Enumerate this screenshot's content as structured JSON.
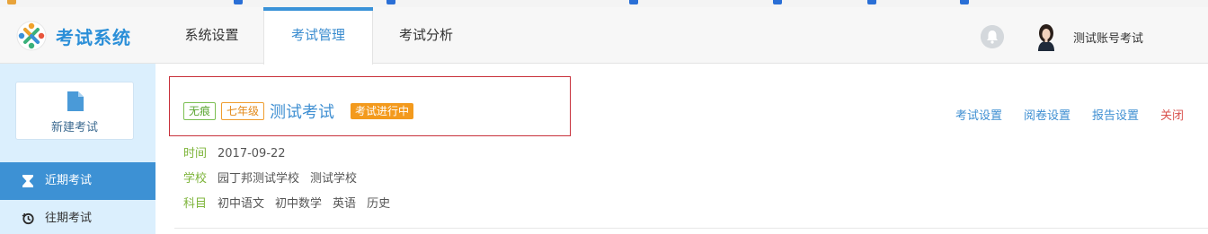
{
  "header": {
    "logo_text": "考试系统",
    "tabs": [
      {
        "label": "系统设置"
      },
      {
        "label": "考试管理"
      },
      {
        "label": "考试分析"
      }
    ],
    "user_name": "测试账号考试"
  },
  "sidebar": {
    "new_exam_label": "新建考试",
    "items": [
      {
        "label": "近期考试"
      },
      {
        "label": "往期考试"
      }
    ]
  },
  "exam": {
    "tags": [
      "无痕",
      "七年级"
    ],
    "title": "测试考试",
    "status": "考试进行中",
    "time_label": "时间",
    "time_value": "2017-09-22",
    "school_label": "学校",
    "schools": [
      "园丁邦测试学校",
      "测试学校"
    ],
    "subject_label": "科目",
    "subjects": [
      "初中语文",
      "初中数学",
      "英语",
      "历史"
    ]
  },
  "actions": {
    "exam_settings": "考试设置",
    "marking_settings": "阅卷设置",
    "report_settings": "报告设置",
    "close": "关闭"
  },
  "colors": {
    "accent": "#3d91d4",
    "tag_green": "#5aa532",
    "tag_orange": "#e38a1a",
    "status_orange": "#f39a1d",
    "highlight_red": "#c8313b",
    "sidebar_bg": "#dbeffd"
  }
}
